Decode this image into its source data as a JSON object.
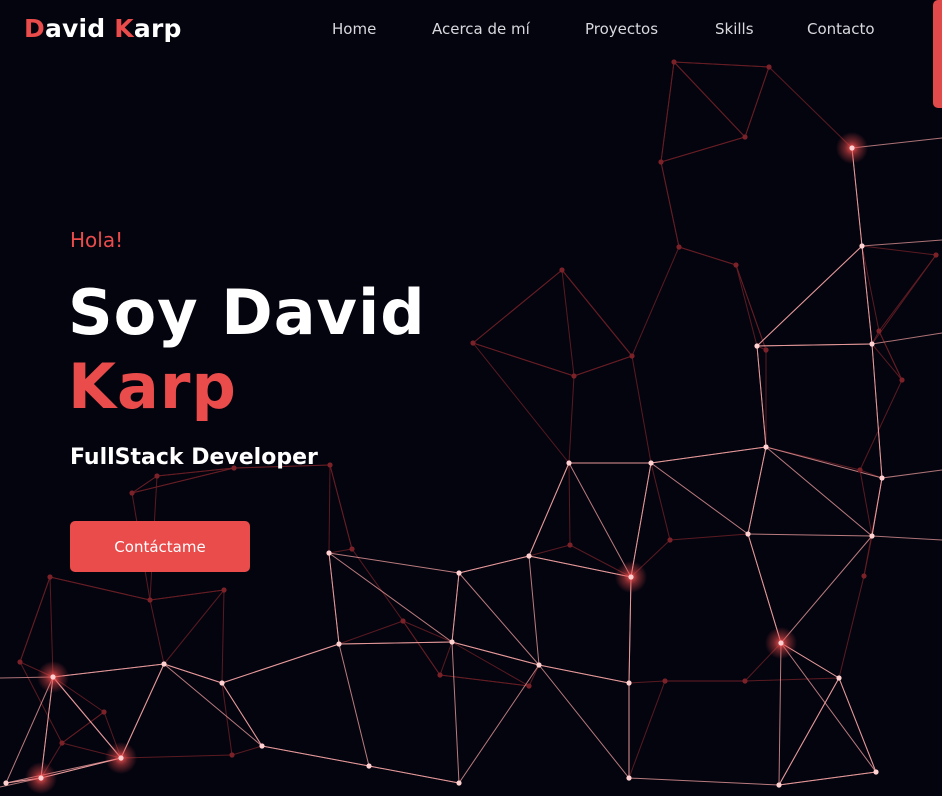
{
  "brand": {
    "first_initial": "D",
    "first_rest": "avid ",
    "last_initial": "K",
    "last_rest": "arp"
  },
  "nav": {
    "items": [
      {
        "label": "Home"
      },
      {
        "label": "Acerca de mí"
      },
      {
        "label": "Proyectos"
      },
      {
        "label": "Skills"
      },
      {
        "label": "Contacto"
      }
    ]
  },
  "hero": {
    "greeting": "Hola!",
    "headline_line1": "Soy David",
    "headline_line2": "Karp",
    "role": "FullStack Developer",
    "cta_label": "Contáctame"
  },
  "colors": {
    "background": "#04040f",
    "accent": "#ea4b4b",
    "line_bright": "#f5a3a3",
    "line_dim": "#6a1f25",
    "node_bright": "#ffd1d1",
    "node_dim": "#7a2228"
  }
}
